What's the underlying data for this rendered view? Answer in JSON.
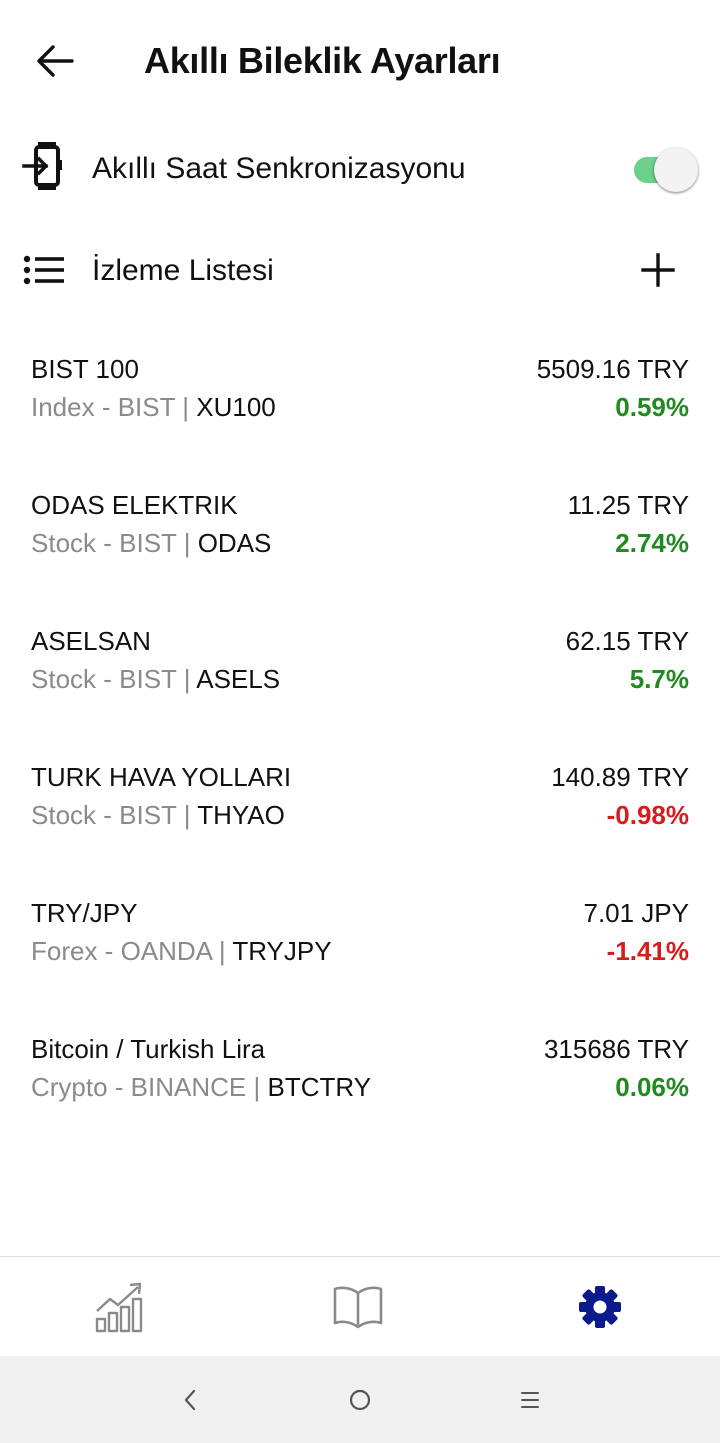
{
  "header": {
    "title": "Akıllı Bileklik Ayarları",
    "back_icon": "arrow-left-icon"
  },
  "sync": {
    "label": "Akıllı Saat Senkronizasyonu",
    "icon": "watch-sync-icon",
    "enabled": true,
    "toggle_color": "#6ad08a"
  },
  "watchlist": {
    "label": "İzleme Listesi",
    "icon": "list-icon",
    "add_icon": "plus-icon",
    "items": [
      {
        "name": "BIST 100",
        "type": "Index - BIST",
        "separator": "|",
        "symbol": "XU100",
        "price": "5509.16 TRY",
        "change": "0.59%",
        "direction": "up"
      },
      {
        "name": "ODAS ELEKTRIK",
        "type": "Stock - BIST",
        "separator": "|",
        "symbol": "ODAS",
        "price": "11.25 TRY",
        "change": "2.74%",
        "direction": "up"
      },
      {
        "name": "ASELSAN",
        "type": "Stock - BIST",
        "separator": "|",
        "symbol": "ASELS",
        "price": "62.15 TRY",
        "change": "5.7%",
        "direction": "up"
      },
      {
        "name": "TURK HAVA YOLLARI",
        "type": "Stock - BIST",
        "separator": "|",
        "symbol": "THYAO",
        "price": "140.89 TRY",
        "change": "-0.98%",
        "direction": "down"
      },
      {
        "name": "TRY/JPY",
        "type": "Forex - OANDA",
        "separator": "|",
        "symbol": "TRYJPY",
        "price": "7.01 JPY",
        "change": "-1.41%",
        "direction": "down"
      },
      {
        "name": "Bitcoin / Turkish Lira",
        "type": "Crypto - BINANCE",
        "separator": "|",
        "symbol": "BTCTRY",
        "price": "315686 TRY",
        "change": "0.06%",
        "direction": "up"
      }
    ]
  },
  "colors": {
    "positive": "#1f8a1f",
    "negative": "#d81b1b",
    "active_nav": "#0b1a8c",
    "inactive_nav": "#8a8a8a"
  },
  "bottom_nav": {
    "items": [
      {
        "icon": "chart-growth-icon",
        "active": false
      },
      {
        "icon": "book-icon",
        "active": false
      },
      {
        "icon": "gear-icon",
        "active": true
      }
    ]
  },
  "system_nav": {
    "items": [
      "back-icon",
      "home-icon",
      "recents-icon"
    ]
  }
}
